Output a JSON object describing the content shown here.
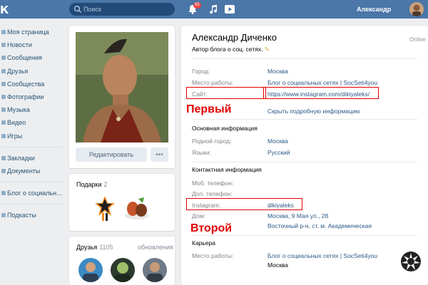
{
  "topbar": {
    "logo": "К",
    "search_placeholder": "Поиск",
    "notif_count": "95",
    "user_name": "Александр"
  },
  "sidebar": {
    "items": [
      "Моя страница",
      "Новости",
      "Сообщения",
      "Друзья",
      "Сообщества",
      "Фотографии",
      "Музыка",
      "Видео",
      "Игры"
    ],
    "items2": [
      "Закладки",
      "Документы"
    ],
    "items3": [
      "Блог о социальн..."
    ],
    "items4": [
      "Подкасты"
    ]
  },
  "profile_left": {
    "edit_label": "Редактировать",
    "more_label": "•••",
    "gifts_title": "Подарки",
    "gifts_count": "2",
    "friends_title": "Друзья",
    "friends_count": "1105",
    "friends_updates": "обновления"
  },
  "profile": {
    "name": "Александр Диченко",
    "online": "Online",
    "status": "Автор блога о соц. сетях.",
    "fields": [
      {
        "label": "Город:",
        "value": "Москва"
      },
      {
        "label": "Место работы:",
        "value": "Блог о социальных сетях | SocSeti4you"
      },
      {
        "label": "Сайт:",
        "value": "https://www.instagram.com/dikiyaleks/"
      }
    ],
    "show_more": "Скрыть подробную информацию",
    "basic_title": "Основная информация",
    "basic": [
      {
        "label": "Родной город:",
        "value": "Москва"
      },
      {
        "label": "Языки:",
        "value": "Русский"
      }
    ],
    "contact_title": "Контактная информация",
    "contact": [
      {
        "label": "Моб. телефон:",
        "value": ""
      },
      {
        "label": "Доп. телефон:",
        "value": ""
      },
      {
        "label": "Instagram:",
        "value": "dikiyaleks"
      },
      {
        "label": "Дом:",
        "value": "Москва, 9 Мая ул., 28"
      },
      {
        "label": "",
        "value": "Восточный р-н, ст. м. Академическая"
      }
    ],
    "career_title": "Карьера",
    "career": [
      {
        "label": "Место работы:",
        "value": "Блог о социальных сетях | SocSeti4you"
      },
      {
        "label": "",
        "value": "Москва"
      }
    ]
  },
  "annotations": {
    "first": "Первый",
    "second": "Второй"
  },
  "colors": {
    "topbar": "#4a76a8",
    "link": "#2a5885",
    "highlight": "#e00000"
  }
}
